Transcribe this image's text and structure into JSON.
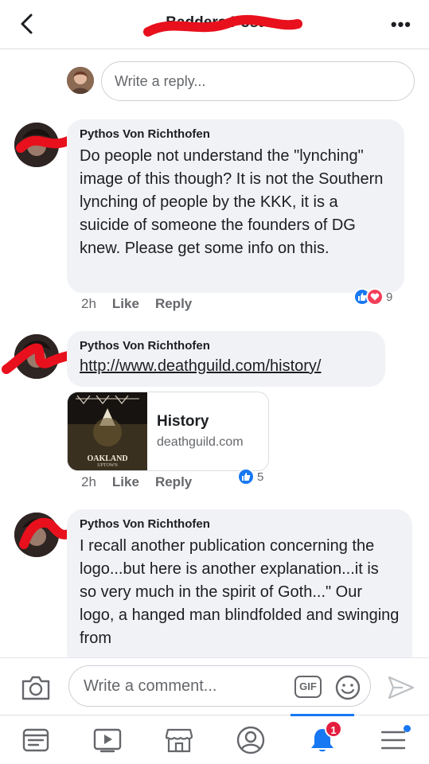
{
  "header": {
    "title": "Badders Post",
    "more_label": "•••"
  },
  "reply": {
    "placeholder": "Write a reply..."
  },
  "comments": [
    {
      "author": "Pythos Von Richthofen",
      "text": "Do people not understand the \"lynching\" image of this though?  It is not the Southern lynching of people by the KKK, it is a suicide of someone the founders of DG knew.  Please get some info on this.",
      "time": "2h",
      "like_label": "Like",
      "reply_label": "Reply",
      "reaction_count": "9",
      "reactions": [
        "like",
        "love"
      ]
    },
    {
      "author": "Pythos Von Richthofen",
      "link_url": "http://www.deathguild.com/history/",
      "link_card": {
        "title": "History",
        "domain": "deathguild.com",
        "thumb_caption": "OAKLAND",
        "thumb_sub": "UPTOWN"
      },
      "time": "2h",
      "like_label": "Like",
      "reply_label": "Reply",
      "reaction_count": "5",
      "reactions": [
        "like"
      ]
    },
    {
      "author": "Pythos Von Richthofen",
      "text": "I recall another publication concerning the logo...but here is another explanation...it is so very much in the spirit of Goth...\" Our logo, a hanged man blindfolded and swinging from"
    }
  ],
  "composer": {
    "placeholder": "Write a comment...",
    "gif_label": "GIF"
  },
  "tabbar": {
    "notifications_badge": "1",
    "active_tab": "notifications"
  },
  "colors": {
    "accent": "#1877f2",
    "bubble": "#f0f2f5",
    "badge": "#e41e3f",
    "scribble": "#e8101c"
  }
}
